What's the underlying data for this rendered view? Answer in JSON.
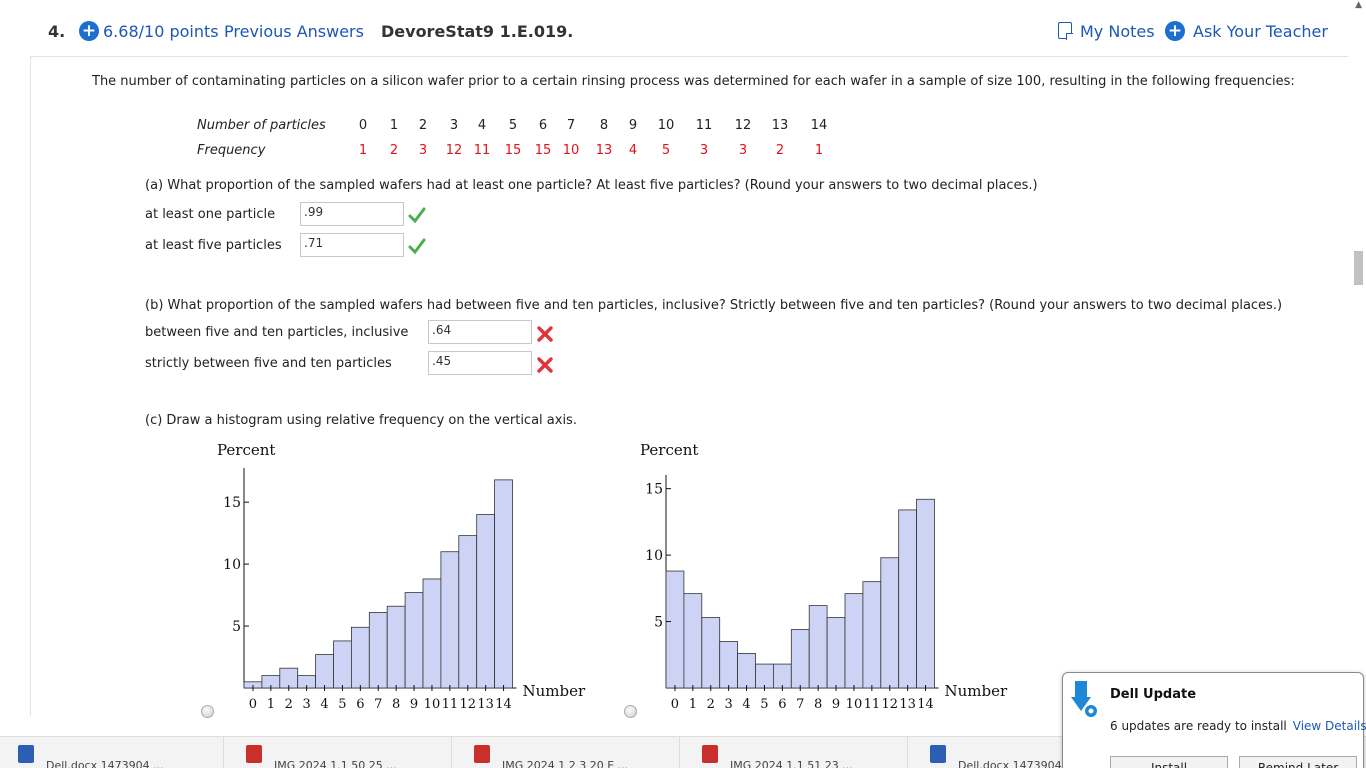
{
  "header": {
    "question_number": "4.",
    "points": "6.68/10 points",
    "previous_answers": "Previous Answers",
    "question_id": "DevoreStat9 1.E.019.",
    "my_notes": "My Notes",
    "ask_teacher": "Ask Your Teacher"
  },
  "problem": {
    "intro": "The number of contaminating particles on a silicon wafer prior to a certain rinsing process was determined for each wafer in a sample of size 100, resulting in the following frequencies:",
    "table": {
      "row1_label": "Number of particles",
      "row2_label": "Frequency",
      "particles": [
        "0",
        "1",
        "2",
        "3",
        "4",
        "5",
        "6",
        "7",
        "8",
        "9",
        "10",
        "11",
        "12",
        "13",
        "14"
      ],
      "frequencies": [
        "1",
        "2",
        "3",
        "12",
        "11",
        "15",
        "15",
        "10",
        "13",
        "4",
        "5",
        "3",
        "3",
        "2",
        "1"
      ]
    },
    "part_a": {
      "question": "(a) What proportion of the sampled wafers had at least one particle? At least five particles? (Round your answers to two decimal places.)",
      "row1_label": "at least one particle",
      "row1_value": ".99",
      "row2_label": "at least five particles",
      "row2_value": ".71"
    },
    "part_b": {
      "question": "(b) What proportion of the sampled wafers had between five and ten particles, inclusive? Strictly between five and ten particles? (Round your answers to two decimal places.)",
      "row1_label": "between five and ten particles, inclusive",
      "row1_value": ".64",
      "row2_label": "strictly between five and ten particles",
      "row2_value": ".45"
    },
    "part_c": {
      "question": "(c) Draw a histogram using relative frequency on the vertical axis."
    }
  },
  "chart_data": [
    {
      "type": "bar",
      "ylabel": "Percent",
      "xlabel": "Number",
      "categories": [
        "0",
        "1",
        "2",
        "3",
        "4",
        "5",
        "6",
        "7",
        "8",
        "9",
        "10",
        "11",
        "12",
        "13",
        "14"
      ],
      "values": [
        0.5,
        1.0,
        1.6,
        1.0,
        2.7,
        3.8,
        4.9,
        6.1,
        6.6,
        7.7,
        8.8,
        11.0,
        12.3,
        14.0,
        16.8
      ],
      "yticks": [
        5,
        10,
        15
      ],
      "ylim": [
        0,
        18
      ]
    },
    {
      "type": "bar",
      "ylabel": "Percent",
      "xlabel": "Number",
      "categories": [
        "0",
        "1",
        "2",
        "3",
        "4",
        "5",
        "6",
        "7",
        "8",
        "9",
        "10",
        "11",
        "12",
        "13",
        "14"
      ],
      "values": [
        8.8,
        7.1,
        5.3,
        3.5,
        2.6,
        1.8,
        1.8,
        4.4,
        6.2,
        5.3,
        7.1,
        8.0,
        9.8,
        13.4,
        14.2
      ],
      "yticks": [
        5,
        10,
        15
      ],
      "ylim": [
        0,
        15.5
      ]
    }
  ],
  "taskbar": [
    {
      "label": "Dell.docx  1473904  ..."
    },
    {
      "label": "IMG 2024 1.1 50 25 ..."
    },
    {
      "label": "IMG 2024 1 2 3 20 E ..."
    },
    {
      "label": "IMG 2024 1.1 51 23 ..."
    },
    {
      "label": "Dell.docx  1473904 ..."
    }
  ],
  "popup": {
    "title": "Dell Update",
    "message": "6 updates are ready to install",
    "link": "View Details",
    "install": "Install",
    "remind": "Remind Later"
  },
  "colors": {
    "link": "#1d57b7",
    "bar_fill": "#ccd3f4",
    "red_value": "#e0121c",
    "check": "#4cae4c",
    "cross": "#e0333a"
  }
}
